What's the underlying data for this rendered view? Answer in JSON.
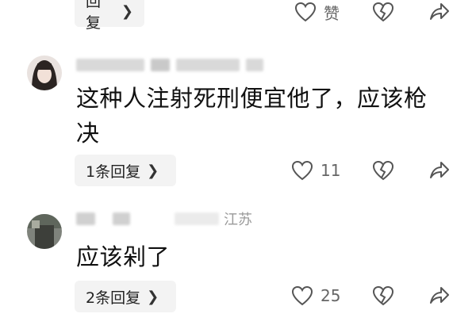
{
  "comments": [
    {
      "reply_label": "回复",
      "like_label": "赞"
    },
    {
      "text_line1": "这种人注射死刑便宜他了，应该枪",
      "text_line2": "决",
      "reply_label": "1条回复",
      "like_count": "11"
    },
    {
      "location": "江苏",
      "text": "应该剁了",
      "reply_label": "2条回复",
      "like_count": "25"
    }
  ],
  "icons": {
    "like": "heart-outline-icon",
    "dislike": "broken-heart-icon",
    "share": "share-arrow-icon",
    "chevron": "chevron-right-icon"
  }
}
